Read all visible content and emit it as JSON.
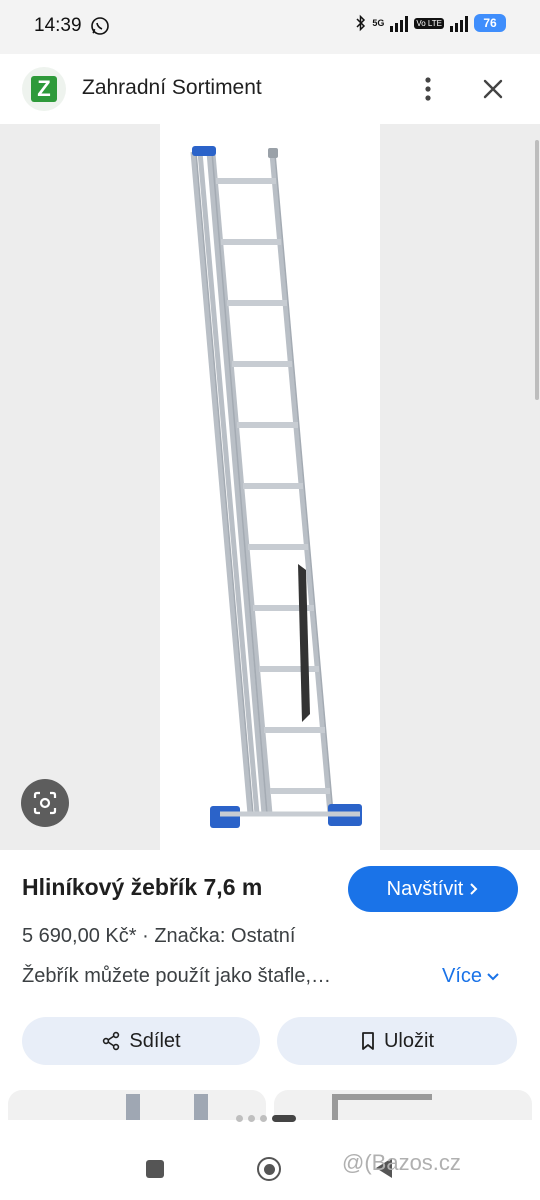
{
  "status_bar": {
    "time": "14:39",
    "network_label": "5G",
    "volte_label": "Vo LTE",
    "battery_level": "76"
  },
  "header": {
    "logo_letter": "Z",
    "site_name": "Zahradní Sortiment"
  },
  "product": {
    "title": "Hliníkový žebřík 7,6 m",
    "visit_label": "Navštívit",
    "price": "5 690,00 Kč*",
    "brand": "Značka: Ostatní",
    "description": "Žebřík můžete použít jako štafle,…",
    "more_label": "Více"
  },
  "actions": {
    "share_label": "Sdílet",
    "save_label": "Uložit"
  },
  "carousel": {
    "page_count": 4,
    "active_index": 3
  },
  "watermark": "@(Bazos.cz",
  "colors": {
    "accent": "#1a73e8",
    "pill_bg": "#e8eef8",
    "logo_green": "#2e9a3a",
    "ladder_blue": "#2b63c9"
  }
}
